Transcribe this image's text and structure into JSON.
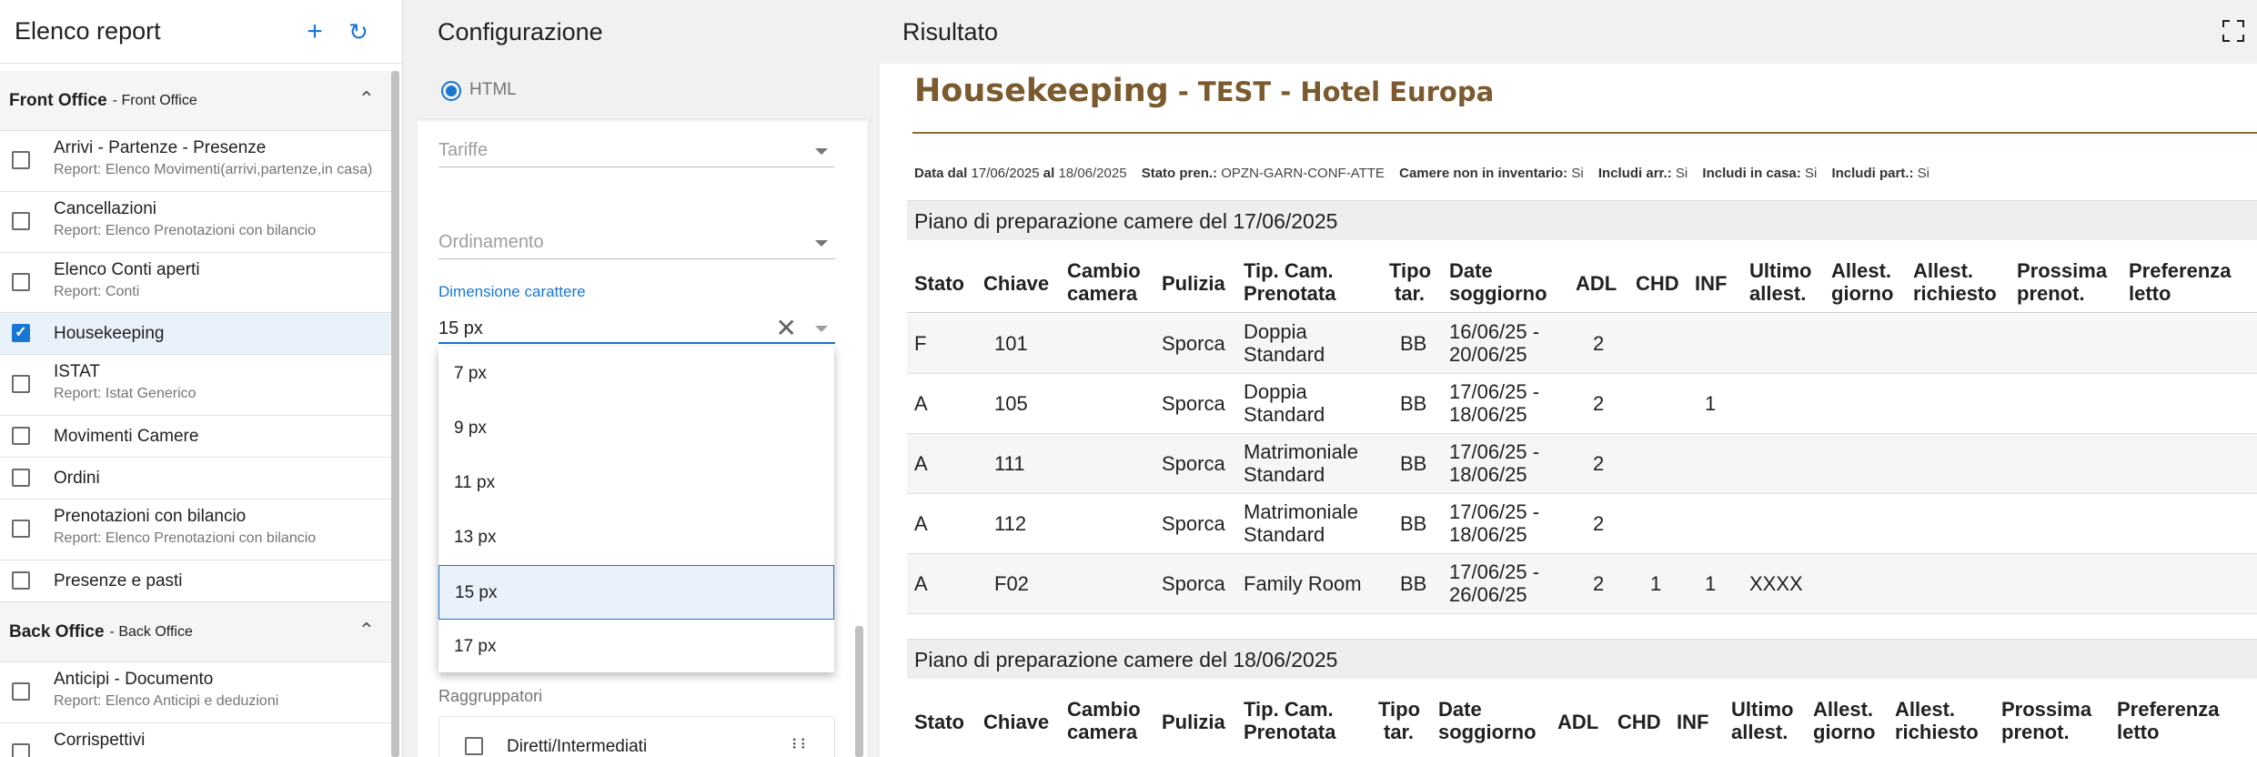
{
  "left": {
    "title": "Elenco report",
    "add_icon": "plus-icon",
    "refresh_icon": "refresh-icon",
    "groups": [
      {
        "name": "Front Office",
        "sub": "- Front Office"
      },
      {
        "name": "Back Office",
        "sub": "- Back Office"
      }
    ],
    "items": [
      {
        "label": "Arrivi - Partenze - Presenze",
        "sub": "Report: Elenco Movimenti(arrivi,partenze,in casa)",
        "checked": false
      },
      {
        "label": "Cancellazioni",
        "sub": "Report: Elenco Prenotazioni con bilancio",
        "checked": false
      },
      {
        "label": "Elenco Conti aperti",
        "sub": "Report: Conti",
        "checked": false
      },
      {
        "label": "Housekeeping",
        "sub": "",
        "checked": true
      },
      {
        "label": "ISTAT",
        "sub": "Report: Istat Generico",
        "checked": false
      },
      {
        "label": "Movimenti Camere",
        "sub": "",
        "checked": false
      },
      {
        "label": "Ordini",
        "sub": "",
        "checked": false
      },
      {
        "label": "Prenotazioni con bilancio",
        "sub": "Report: Elenco Prenotazioni con bilancio",
        "checked": false
      },
      {
        "label": "Presenze e pasti",
        "sub": "",
        "checked": false
      },
      {
        "label": "Anticipi - Documento",
        "sub": "Report: Elenco Anticipi e deduzioni",
        "checked": false
      },
      {
        "label": "Corrispettivi",
        "sub": "",
        "checked": false
      }
    ]
  },
  "mid": {
    "title": "Configurazione",
    "format_label": "HTML",
    "tariffe": "Tariffe",
    "ordinamento": "Ordinamento",
    "dim_label": "Dimensione carattere",
    "dim_value": "15 px",
    "options": [
      "7 px",
      "9 px",
      "11 px",
      "13 px",
      "15 px",
      "17 px"
    ],
    "selected_option": "15 px",
    "raggruppatori_label": "Raggruppatori",
    "raggruppatori_item": "Diretti/Intermediati",
    "drag_icon": "drag-handle-icon",
    "clear_icon": "close-icon"
  },
  "right": {
    "title": "Risultato",
    "fullscreen_icon": "fullscreen-icon",
    "report_title_main": "Housekeeping",
    "report_title_sep": " - ",
    "report_title_sub": "TEST - Hotel Europa",
    "filters": [
      {
        "k": "Data dal",
        "v": "17/06/2025"
      },
      {
        "k": "al",
        "v": "18/06/2025"
      },
      {
        "k": "Stato pren.:",
        "v": "OPZN-GARN-CONF-ATTE"
      },
      {
        "k": "Camere non in inventario:",
        "v": "Si"
      },
      {
        "k": "Includi arr.:",
        "v": "Si"
      },
      {
        "k": "Includi in casa:",
        "v": "Si"
      },
      {
        "k": "Includi part.:",
        "v": "Si"
      }
    ],
    "section1": "Piano di preparazione camere del 17/06/2025",
    "section2": "Piano di preparazione camere del 18/06/2025",
    "headers": {
      "stato": "Stato",
      "chiave": "Chiave",
      "cambio1": "Cambio",
      "cambio2": "camera",
      "pulizia": "Pulizia",
      "tipcam1": "Tip. Cam.",
      "tipcam2": "Prenotata",
      "tipotar1": "Tipo",
      "tipotar2": "tar.",
      "data1": "Date",
      "data2": "soggiorno",
      "adl": "ADL",
      "chd": "CHD",
      "inf": "INF",
      "ultimo1": "Ultimo",
      "ultimo2": "allest.",
      "allg1": "Allest.",
      "allg2": "giorno",
      "allr1": "Allest.",
      "allr2": "richiesto",
      "pross1": "Prossima",
      "pross2": "prenot.",
      "pref1": "Preferenza",
      "pref2": "letto"
    },
    "rows": [
      {
        "stato": "F",
        "chiave": "101",
        "pulizia": "Sporca",
        "tip1": "Doppia",
        "tip2": "Standard",
        "tar": "BB",
        "d1": "16/06/25 -",
        "d2": "20/06/25",
        "adl": "2",
        "chd": "",
        "inf": "",
        "ult": ""
      },
      {
        "stato": "A",
        "chiave": "105",
        "pulizia": "Sporca",
        "tip1": "Doppia",
        "tip2": "Standard",
        "tar": "BB",
        "d1": "17/06/25 -",
        "d2": "18/06/25",
        "adl": "2",
        "chd": "",
        "inf": "1",
        "ult": ""
      },
      {
        "stato": "A",
        "chiave": "111",
        "pulizia": "Sporca",
        "tip1": "Matrimoniale",
        "tip2": "Standard",
        "tar": "BB",
        "d1": "17/06/25 -",
        "d2": "18/06/25",
        "adl": "2",
        "chd": "",
        "inf": "",
        "ult": ""
      },
      {
        "stato": "A",
        "chiave": "112",
        "pulizia": "Sporca",
        "tip1": "Matrimoniale",
        "tip2": "Standard",
        "tar": "BB",
        "d1": "17/06/25 -",
        "d2": "18/06/25",
        "adl": "2",
        "chd": "",
        "inf": "",
        "ult": ""
      },
      {
        "stato": "A",
        "chiave": "F02",
        "pulizia": "Sporca",
        "tip1": "Family Room",
        "tip2": "",
        "tar": "BB",
        "d1": "17/06/25 -",
        "d2": "26/06/25",
        "adl": "2",
        "chd": "1",
        "inf": "1",
        "ult": "XXXX"
      }
    ],
    "colors": {
      "title_brown": "#7a5a2e",
      "accent_blue": "#1976d2"
    }
  }
}
